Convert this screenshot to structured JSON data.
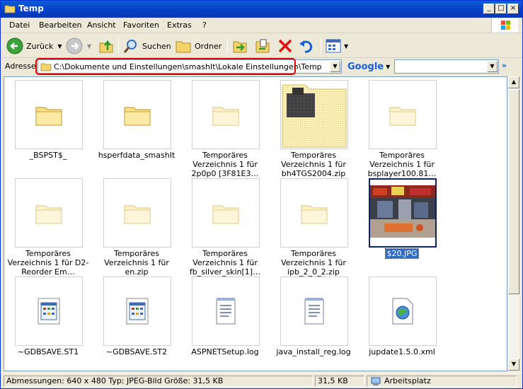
{
  "window": {
    "title": "Temp"
  },
  "menu": {
    "items": [
      "Datei",
      "Bearbeiten",
      "Ansicht",
      "Favoriten",
      "Extras",
      "?"
    ]
  },
  "toolbar": {
    "back_label": "Zurück",
    "search_label": "Suchen",
    "folders_label": "Ordner"
  },
  "address": {
    "label": "Adresse",
    "path": "C:\\Dokumente und Einstellungen\\smashIt\\Lokale Einstellungen\\Temp"
  },
  "google": {
    "label": "Google",
    "search_value": ""
  },
  "files": [
    {
      "name": "_BSPST$_",
      "type": "folder"
    },
    {
      "name": "hsperfdata_smashIt",
      "type": "folder"
    },
    {
      "name": "Temporäres Verzeichnis 1 für 2p0p0 [3F81E3…",
      "type": "zipfolder"
    },
    {
      "name": "Temporäres Verzeichnis 1 für bh4TGS2004.zip",
      "type": "zipfolder-dither"
    },
    {
      "name": "Temporäres Verzeichnis 1 für bsplayer100.81…",
      "type": "zipfolder"
    },
    {
      "name": "Temporäres Verzeichnis 1 für D2-Reorder Em…",
      "type": "zipfolder"
    },
    {
      "name": "Temporäres Verzeichnis 1 für en.zip",
      "type": "zipfolder"
    },
    {
      "name": "Temporäres Verzeichnis 1 für fb_silver_skin[1]…",
      "type": "zipfolder"
    },
    {
      "name": "Temporäres Verzeichnis 1 für ipb_2_0_2.zip",
      "type": "zipfolder"
    },
    {
      "name": "$20.JPG",
      "type": "photo",
      "selected": true
    },
    {
      "name": "~GDBSAVE.ST1",
      "type": "appfile"
    },
    {
      "name": "~GDBSAVE.ST2",
      "type": "appfile"
    },
    {
      "name": "ASPNETSetup.log",
      "type": "textfile"
    },
    {
      "name": "java_install_reg.log",
      "type": "textfile"
    },
    {
      "name": "jupdate1.5.0.xml",
      "type": "xmlfile"
    }
  ],
  "status": {
    "details": "Abmessungen: 640 x 480 Typ: JPEG-Bild Größe: 31,5 KB",
    "size": "31,5 KB",
    "zone": "Arbeitsplatz"
  },
  "colors": {
    "title_blue": "#0846c8",
    "selection": "#316ac5",
    "highlight_red": "#e00000"
  }
}
